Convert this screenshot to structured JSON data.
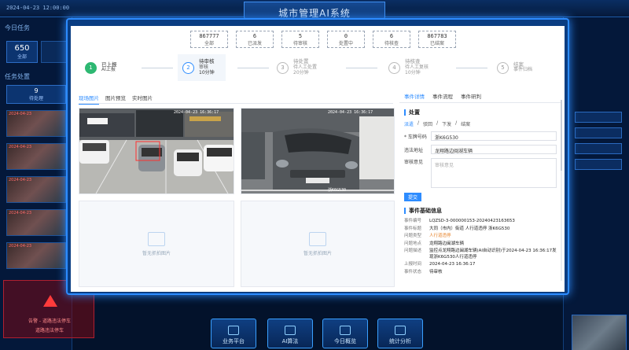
{
  "header": {
    "title": "城市管理AI系统",
    "clock": "2024-04-23 12:00:00"
  },
  "bg_left": {
    "section1": "今日任务",
    "stat_value": "650",
    "stat_label": "全部",
    "section2": "任务处置",
    "tab_value": "9",
    "tab_label": "待处理",
    "thumbs": [
      {
        "time": "2024-04-23"
      },
      {
        "time": "2024-04-23"
      },
      {
        "time": "2024-04-23"
      },
      {
        "time": "2024-04-23"
      },
      {
        "time": "2024-04-23"
      }
    ],
    "alert_line1": "告警 - 道路违法停车",
    "alert_line2": "道路违法停车"
  },
  "bottom_nav": [
    {
      "label": "业务平台"
    },
    {
      "label": "AI算法"
    },
    {
      "label": "今日概览"
    },
    {
      "label": "统计分析"
    }
  ],
  "modal": {
    "stats": [
      {
        "num": "867777",
        "label": "全部"
      },
      {
        "num": "6",
        "label": "已派发"
      },
      {
        "num": "5",
        "label": "待审核"
      },
      {
        "num": "0",
        "label": "处置中"
      },
      {
        "num": "6",
        "label": "待核查"
      },
      {
        "num": "867783",
        "label": "已结案"
      }
    ],
    "steps": [
      {
        "num": "1",
        "line1": "已上报",
        "line2": "AI上报",
        "line3": "",
        "state": "done"
      },
      {
        "num": "2",
        "line1": "待审核",
        "line2": "审核",
        "line3": "10分钟",
        "state": "active"
      },
      {
        "num": "3",
        "line1": "待处置",
        "line2": "待人工处置",
        "line3": "20分钟",
        "state": "pending"
      },
      {
        "num": "4",
        "line1": "待核查",
        "line2": "待人工复核",
        "line3": "10分钟",
        "state": "pending"
      },
      {
        "num": "5",
        "line1": "结案",
        "line2": "事件归档",
        "line3": "",
        "state": "pending"
      }
    ],
    "image_tabs": [
      "现场图片",
      "图片预览",
      "实时图片"
    ],
    "photo1_ts": "2024-04-23 16:36:17",
    "photo2_ts": "2024-04-23 16:36:17",
    "photo2_plate": "浙K6G530",
    "empty_caption": "暂无抓拍图片",
    "right_tabs": [
      "事件详情",
      "事件流程",
      "事件研判"
    ],
    "process": {
      "title": "处置",
      "subtabs": [
        "派遣",
        "驳回",
        "下发",
        "结案"
      ],
      "plate_label": "* 车牌号码",
      "plate_value": "浙K6G530",
      "addr_label": "违法地址",
      "addr_value": "龙翔路边闽湖车辆",
      "opinion_label": "审核意见",
      "opinion_placeholder": "审核意见",
      "submit": "提交"
    },
    "info": {
      "title": "事件基础信息",
      "rows": [
        {
          "k": "事件编号",
          "v": "LQZSD-3-000000153-20240423163653",
          "red": false
        },
        {
          "k": "事件标题",
          "v": "大同（市内）街道 人行道违停 浙K6G530",
          "red": false
        },
        {
          "k": "问题类型",
          "v": "人行道违停",
          "red": true
        },
        {
          "k": "问题地点",
          "v": "龙翔路边闽湖车辆",
          "red": false
        },
        {
          "k": "问题描述",
          "v": "监控点龙翔路边闽湖车辆(AI自动识别)于2024-04-23 16:36:17发现浙K6G530人行道违停",
          "red": false
        },
        {
          "k": "上报时间",
          "v": "2024-04-23 16:36:17",
          "red": false
        },
        {
          "k": "事件状态",
          "v": "待审核",
          "red": false
        }
      ]
    }
  }
}
